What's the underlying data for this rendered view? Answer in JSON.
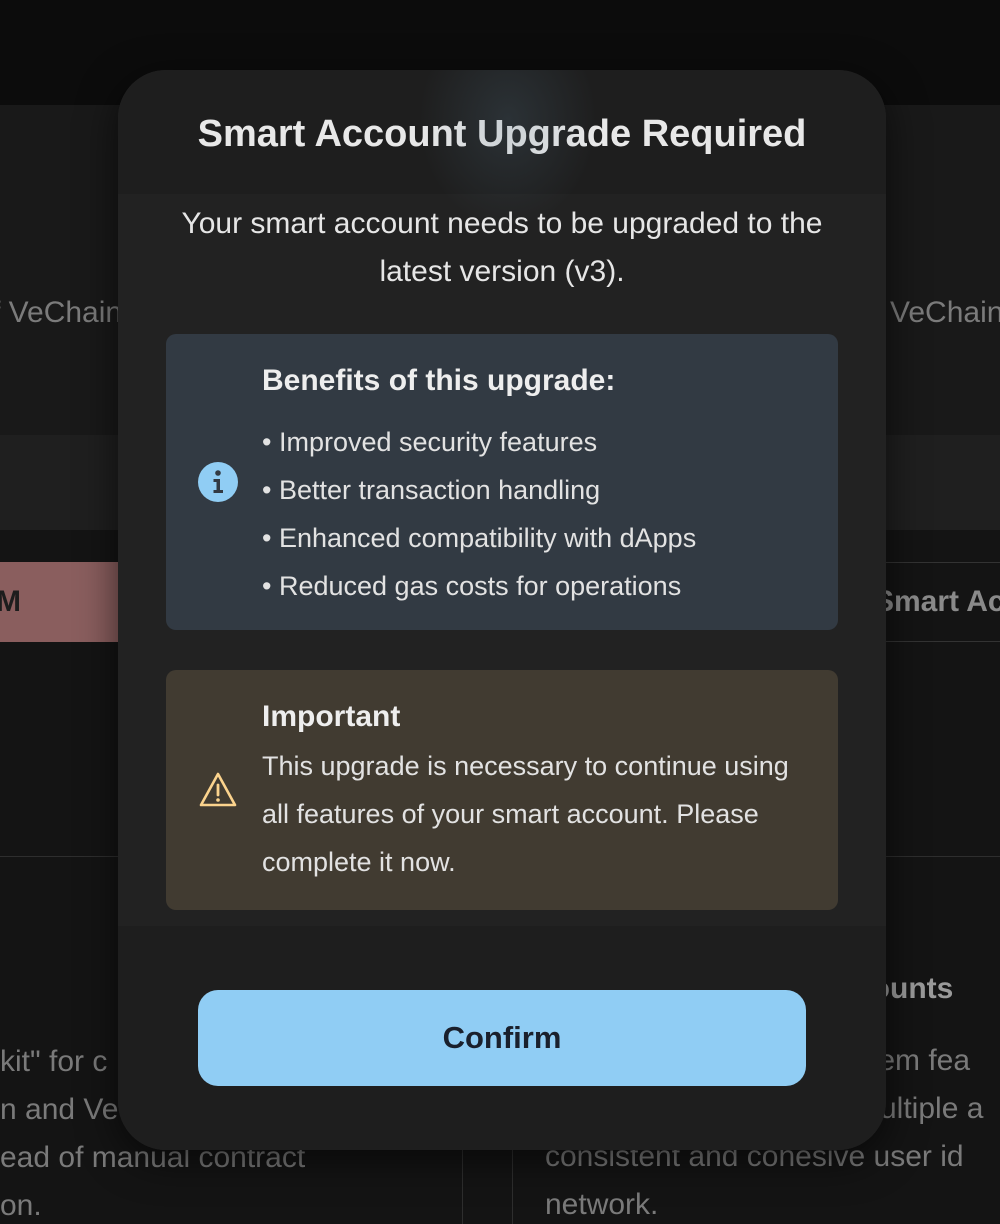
{
  "background": {
    "left_vechain": "f VeChain",
    "right_vechain": "VeChain",
    "red_button": "M",
    "right_tab": "Smart Ac",
    "right_heading": "counts",
    "left_lines": [
      "kit\" for c",
      "n and VeC",
      "ead of manual contract",
      "on."
    ],
    "right_lines": [
      "stem fea",
      "multiple a",
      "consistent and cohesive user id",
      "network."
    ]
  },
  "modal": {
    "title": "Smart Account Upgrade Required",
    "description": "Your smart account needs to be upgraded to the latest version (v3).",
    "info": {
      "icon": "info-circle-icon",
      "heading": "Benefits of this upgrade:",
      "items": [
        "Improved security features",
        "Better transaction handling",
        "Enhanced compatibility with dApps",
        "Reduced gas costs for operations"
      ],
      "color": "#90cdf4"
    },
    "warning": {
      "icon": "warning-triangle-icon",
      "heading": "Important",
      "text": "This upgrade is necessary to continue using all features of your smart account. Please complete it now.",
      "color": "#fbd38d"
    },
    "confirm_label": "Confirm",
    "accent": "#90cdf4"
  }
}
